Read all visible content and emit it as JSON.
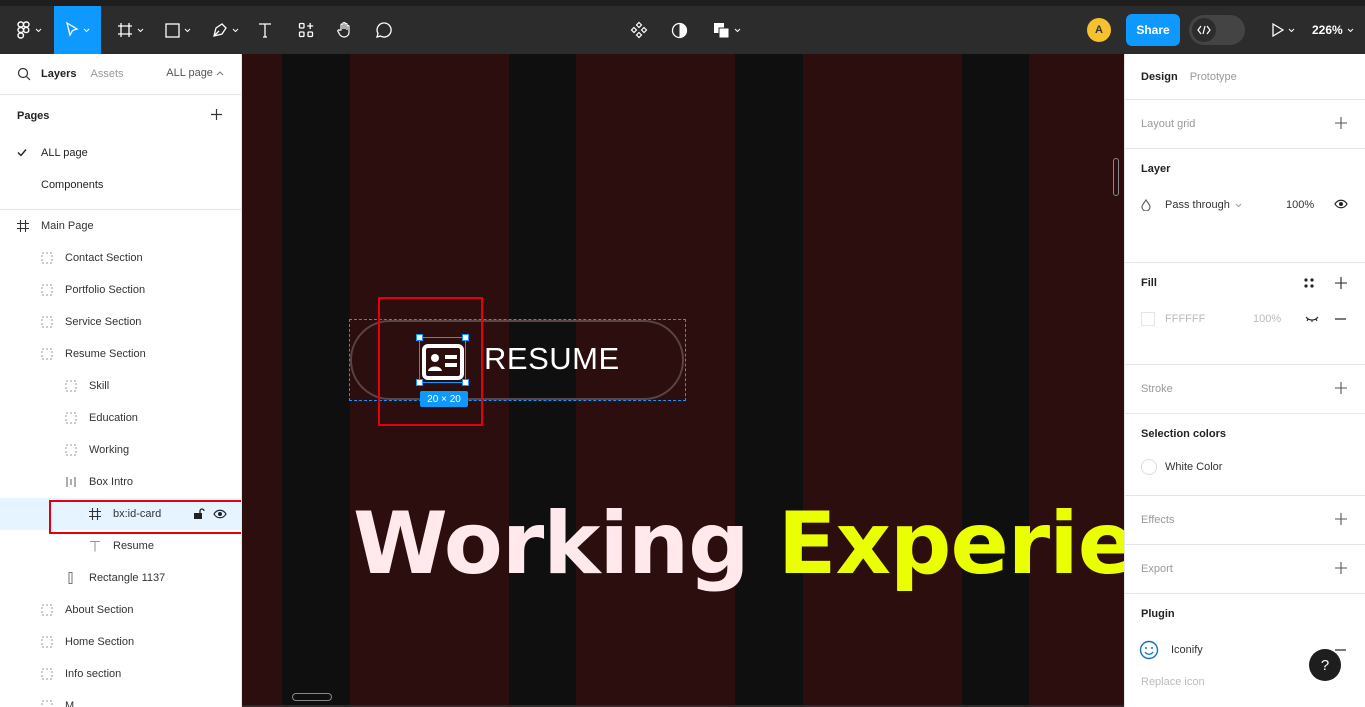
{
  "toolbar": {
    "avatar_initial": "A",
    "share_label": "Share",
    "zoom": "226%"
  },
  "left_panel": {
    "tabs": [
      "Layers",
      "Assets"
    ],
    "page_selector": "ALL page",
    "pages_title": "Pages",
    "pages": [
      "ALL page",
      "Components"
    ],
    "layers": [
      {
        "label": "Main Page",
        "indent": 0,
        "icon": "frame-icon"
      },
      {
        "label": "Contact Section",
        "indent": 1,
        "icon": "section-icon"
      },
      {
        "label": "Portfolio Section",
        "indent": 1,
        "icon": "section-icon"
      },
      {
        "label": "Service Section",
        "indent": 1,
        "icon": "section-icon"
      },
      {
        "label": "Resume Section",
        "indent": 1,
        "icon": "section-icon"
      },
      {
        "label": "Skill",
        "indent": 2,
        "icon": "section-icon"
      },
      {
        "label": "Education",
        "indent": 2,
        "icon": "section-icon"
      },
      {
        "label": "Working",
        "indent": 2,
        "icon": "section-icon"
      },
      {
        "label": "Box Intro",
        "indent": 2,
        "icon": "auto-layout-icon"
      },
      {
        "label": "bx:id-card",
        "indent": 3,
        "icon": "frame-icon",
        "selected": true
      },
      {
        "label": "Resume",
        "indent": 3,
        "icon": "text-icon"
      },
      {
        "label": "Rectangle 1137",
        "indent": 2,
        "icon": "rectangle-icon"
      },
      {
        "label": "About Section",
        "indent": 1,
        "icon": "section-icon"
      },
      {
        "label": "Home Section",
        "indent": 1,
        "icon": "section-icon"
      },
      {
        "label": "Info section",
        "indent": 1,
        "icon": "section-icon"
      },
      {
        "label": "M...",
        "indent": 1,
        "icon": "section-icon"
      }
    ]
  },
  "canvas": {
    "button_text": "RESUME",
    "size_tag": "20 × 20",
    "headline_word1": "Working",
    "headline_word2": "Experien",
    "bg_color": "#2c0e0f",
    "stripe_color": "#0f0f0f",
    "headline_color1": "#ffe9ec",
    "headline_color2": "#eaff00"
  },
  "right_panel": {
    "tabs": [
      "Design",
      "Prototype"
    ],
    "layout_grid": "Layout grid",
    "layer_title": "Layer",
    "blend_mode": "Pass through",
    "layer_opacity": "100%",
    "fill_title": "Fill",
    "fill_hex": "FFFFFF",
    "fill_opacity": "100%",
    "stroke_title": "Stroke",
    "selection_colors_title": "Selection colors",
    "selection_color_name": "White Color",
    "effects_title": "Effects",
    "export_title": "Export",
    "plugin_title": "Plugin",
    "plugin_name": "Iconify",
    "replace_icon": "Replace icon"
  },
  "help_label": "?"
}
